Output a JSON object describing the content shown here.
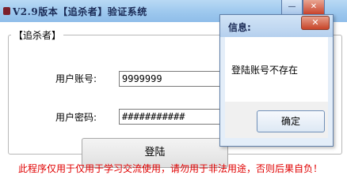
{
  "window": {
    "title": "V2.9版本【追杀者】验证系统",
    "minimize_glyph": "—",
    "close_glyph": "✕"
  },
  "group": {
    "label": "【追杀者】"
  },
  "form": {
    "username_label": "用户账号:",
    "username_value": "9999999",
    "password_label": "用户密码:",
    "password_value": "###########",
    "login_button": "登陆"
  },
  "footer": {
    "warning": "此程序仅用于仅用于学习交流使用，请勿用于非法用途，否则后果自负！"
  },
  "dialog": {
    "title": "信息:",
    "close_glyph": "✕",
    "message": "登陆账号不存在",
    "ok_button": "确定"
  },
  "colors": {
    "warning_text": "#e00000",
    "titlebar": "#9dc8ee"
  }
}
